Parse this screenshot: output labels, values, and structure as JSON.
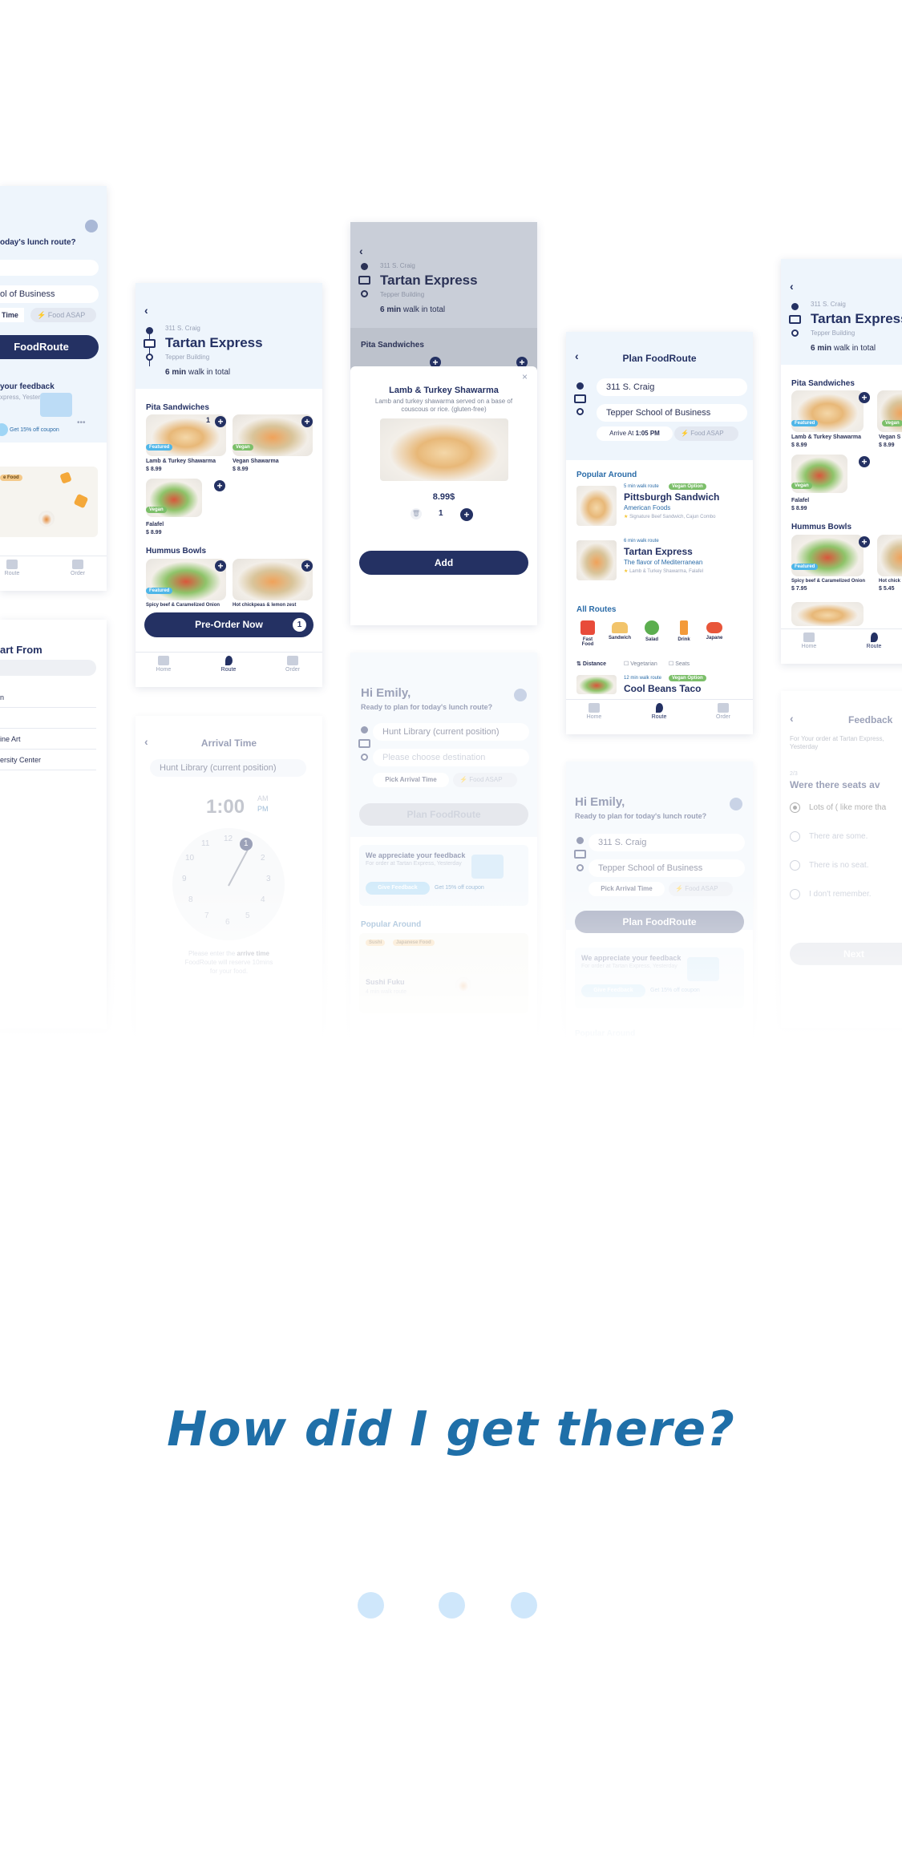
{
  "headline": "How did I get there?",
  "progress_dots": 3,
  "common": {
    "tab_home": "Home",
    "tab_route": "Route",
    "tab_order": "Order",
    "origin": "311 S. Craig",
    "restaurant": "Tartan Express",
    "building": "Tepper Building",
    "walk_minutes": "6 min",
    "walk_suffix": "walk in total",
    "pita_section": "Pita Sandwiches",
    "hummus_section": "Hummus Bowls"
  },
  "screen_left_home": {
    "greeting_partial": "oday's lunch route?",
    "dest_partial": "ol of Business",
    "time_tab_partial": "Time",
    "asap": "Food ASAP",
    "plan_btn_partial": "FoodRoute",
    "feedback_partial": "your feedback",
    "feedback_sub_partial": "xpress, Yesterday",
    "coupon": "Get 15% off coupon",
    "food_tag_partial": "e Food"
  },
  "screen_left_start": {
    "title_partial": "art From",
    "rows": [
      "n",
      "",
      "ine Art",
      "ersity Center"
    ]
  },
  "screen_menu": {
    "items": [
      {
        "name": "Lamb & Turkey Shawarma",
        "price": "$ 8.99",
        "tag": "Featured",
        "qty": "1"
      },
      {
        "name": "Vegan Shawarma",
        "price": "$ 8.99",
        "tag": "Vegan"
      },
      {
        "name": "Falafel",
        "price": "$ 8.99",
        "tag": "Vegan"
      },
      {
        "name": "Spicy beef & Caramelized Onion",
        "price": "",
        "tag": "Featured"
      },
      {
        "name": "Hot chickpeas & lemon zest",
        "price": "",
        "tag": ""
      }
    ],
    "preorder": "Pre-Order Now",
    "cart_count": "1"
  },
  "screen_modal": {
    "title": "Lamb & Turkey Shawarma",
    "desc": "Lamb and turkey shawarma served on a base of couscous or rice. (gluten-free)",
    "price": "8.99$",
    "qty": "1",
    "add": "Add",
    "bg_section": "Pita Sandwiches"
  },
  "screen_plan": {
    "title": "Plan FoodRoute",
    "origin": "311 S. Craig",
    "dest": "Tepper School of Business",
    "arrive_label": "Arrive At",
    "arrive_time": "1:05 PM",
    "asap": "Food ASAP",
    "popular": "Popular Around",
    "results": [
      {
        "walk": "5 min walk route",
        "tag": "Vegan Option",
        "name": "Pittsburgh Sandwich",
        "cuisine": "American Foods",
        "sig": "Signature Beef Sandwich, Cajun Combo"
      },
      {
        "walk": "6 min walk route",
        "tag": "",
        "name": "Tartan Express",
        "cuisine": "The flavor of Mediterranean",
        "sig": "Lamb & Turkey Shawarma, Falafel"
      }
    ],
    "all_routes": "All Routes",
    "categories": [
      "Fast Food",
      "Sandwich",
      "Salad",
      "Drink",
      "Japane"
    ],
    "distance": "Distance",
    "filter_veg": "Vegetarian",
    "filter_seats": "Seats",
    "next_walk": "12 min walk route",
    "next_tag": "Vegan Option",
    "next_name_partial": "Cool Beans Taco"
  },
  "screen_right_menu": {
    "items": [
      {
        "name": "Lamb & Turkey Shawarma",
        "price": "$ 8.99",
        "tag": "Featured"
      },
      {
        "name": "Vegan S",
        "price": "$ 8.99",
        "tag": "Vegan"
      },
      {
        "name": "Falafel",
        "price": "$ 8.99",
        "tag": "Vegan"
      },
      {
        "name": "Spicy beef & Caramelized Onion",
        "price": "$ 7.95",
        "tag": "Featured"
      },
      {
        "name": "Hot chick",
        "price": "$ 5.45",
        "tag": ""
      }
    ]
  },
  "screen_arrival": {
    "title": "Arrival Time",
    "location": "Hunt Library (current position)",
    "time": "1:00",
    "am": "AM",
    "pm": "PM",
    "clock_numbers": [
      "12",
      "1",
      "2",
      "3",
      "4",
      "5",
      "6",
      "7",
      "8",
      "9",
      "10",
      "11"
    ],
    "hint_1": "Please enter the",
    "hint_bold": "arrive time",
    "hint_2": "FoodRoute will reserve 10mins",
    "hint_3": "for your food."
  },
  "screen_hi_emily": {
    "greeting": "Hi Emily,",
    "sub": "Ready to plan for today's lunch route?",
    "origin": "Hunt Library (current position)",
    "dest_placeholder": "Please choose destination",
    "pick": "Pick Arrival Time",
    "asap": "Food ASAP",
    "plan": "Plan FoodRoute",
    "feedback_title": "We appreciate your feedback",
    "feedback_sub": "For order at Tartan Express, Yesterday",
    "give": "Give Feedback",
    "coupon": "Get 15% off coupon",
    "popular": "Popular Around",
    "chips": [
      "Sushi",
      "Japanese Food"
    ],
    "place": "Sushi Fuku",
    "place_sub": "4 min walk route"
  },
  "screen_hi_emily2": {
    "greeting": "Hi Emily,",
    "sub": "Ready to plan for today's lunch route?",
    "origin": "311 S. Craig",
    "dest": "Tepper School of Business",
    "pick": "Pick Arrival Time",
    "asap": "Food ASAP",
    "plan": "Plan FoodRoute",
    "feedback_title": "We appreciate your feedback",
    "feedback_sub": "For order at Tartan Express, Yesterday",
    "give": "Give Feedback",
    "coupon": "Get 15% off coupon",
    "popular": "Popular Around"
  },
  "screen_feedback": {
    "title": "Feedback",
    "sub": "For Your order at Tartan Express, Yesterday",
    "step": "2/3",
    "question": "Were there seats av",
    "options": [
      "Lots of ( like more tha",
      "There are some.",
      "There is no seat.",
      "I don't remember."
    ],
    "next": "Next"
  }
}
